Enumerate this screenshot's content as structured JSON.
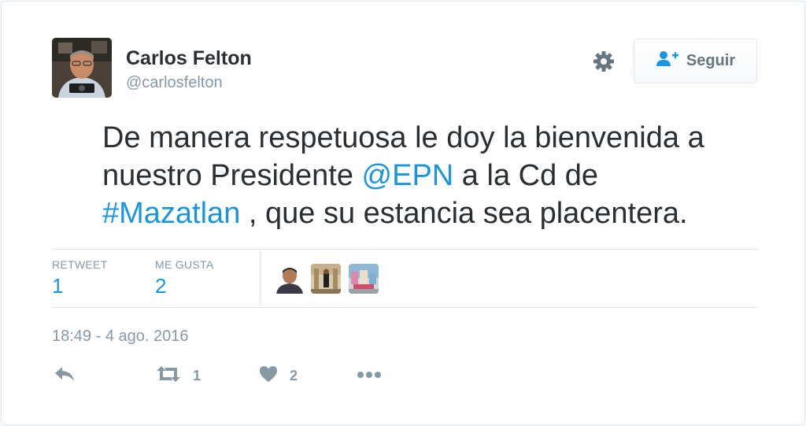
{
  "user": {
    "name": "Carlos Felton",
    "handle": "@carlosfelton"
  },
  "header": {
    "follow_label": "Seguir"
  },
  "tweet": {
    "line1": "De manera respetuosa le doy la bienvenida a",
    "line2_a": "nuestro Presidente ",
    "mention": "@EPN",
    "line2_b": " a la Cd de",
    "hashtag": "#Mazatlan",
    "line3_b": " , que su estancia sea placentera."
  },
  "stats": {
    "retweet_label": "RETWEET",
    "retweet_count": "1",
    "likes_label": "ME GUSTA",
    "likes_count": "2"
  },
  "timestamp": "18:49 - 4 ago. 2016",
  "actions": {
    "retweet_count": "1",
    "like_count": "2"
  },
  "colors": {
    "link": "#1b95e0",
    "muted": "#8899a6",
    "text": "#292f33"
  }
}
